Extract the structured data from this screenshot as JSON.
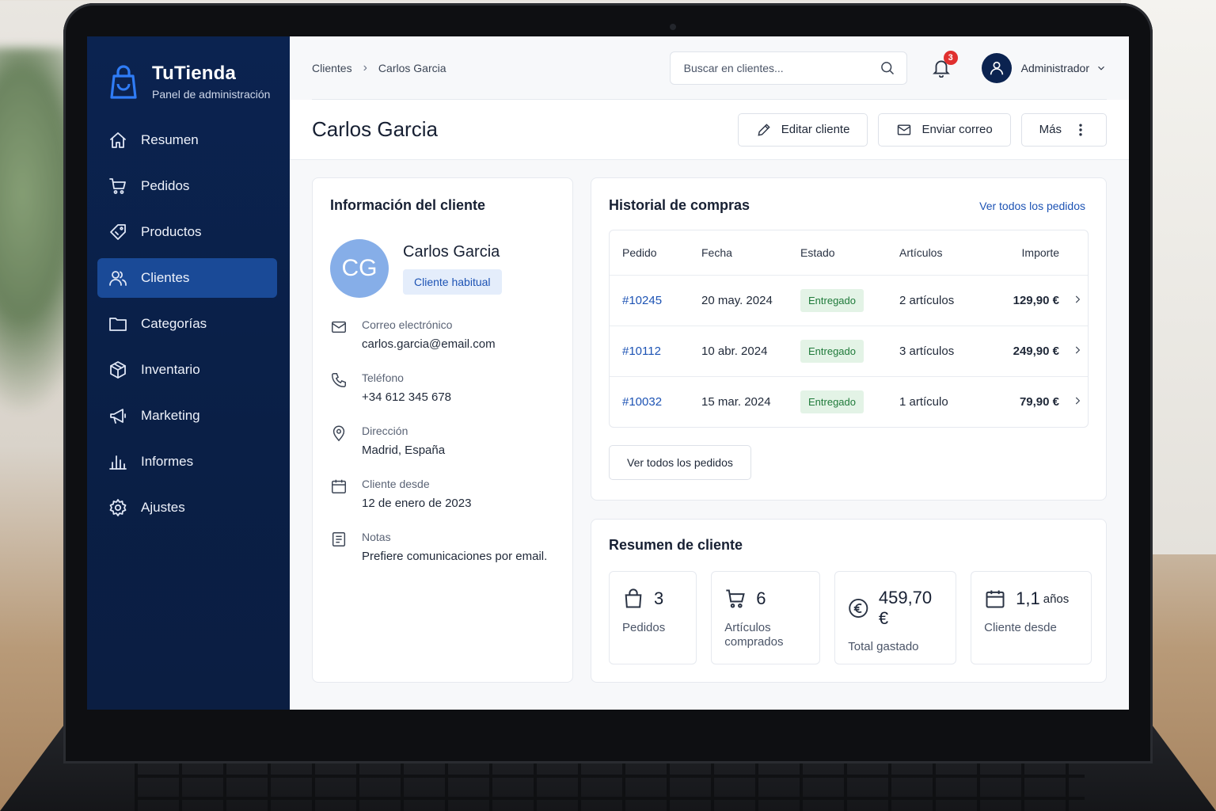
{
  "brand": {
    "name": "TuTienda",
    "subtitle": "Panel de administración"
  },
  "nav": [
    {
      "label": "Resumen",
      "icon": "home-icon",
      "active": false
    },
    {
      "label": "Pedidos",
      "icon": "cart-icon",
      "active": false
    },
    {
      "label": "Productos",
      "icon": "tag-icon",
      "active": false
    },
    {
      "label": "Clientes",
      "icon": "users-icon",
      "active": true
    },
    {
      "label": "Categorías",
      "icon": "folder-icon",
      "active": false
    },
    {
      "label": "Inventario",
      "icon": "box-icon",
      "active": false
    },
    {
      "label": "Marketing",
      "icon": "megaphone-icon",
      "active": false
    },
    {
      "label": "Informes",
      "icon": "bar-chart-icon",
      "active": false
    },
    {
      "label": "Ajustes",
      "icon": "gear-icon",
      "active": false
    }
  ],
  "breadcrumb": {
    "parent": "Clientes",
    "current": "Carlos Garcia"
  },
  "search": {
    "placeholder": "Buscar en clientes..."
  },
  "notifications": {
    "count": "3"
  },
  "user": {
    "name": "Administrador"
  },
  "page": {
    "title": "Carlos Garcia",
    "actions": {
      "edit": "Editar cliente",
      "email": "Enviar correo",
      "more": "Más"
    }
  },
  "client_info": {
    "title": "Información del cliente",
    "initials": "CG",
    "name": "Carlos Garcia",
    "tag": "Cliente habitual",
    "fields": [
      {
        "label": "Correo electrónico",
        "value": "carlos.garcia@email.com",
        "icon": "mail-icon"
      },
      {
        "label": "Teléfono",
        "value": "+34 612 345 678",
        "icon": "phone-icon"
      },
      {
        "label": "Dirección",
        "value": "Madrid, España",
        "icon": "location-icon"
      },
      {
        "label": "Cliente desde",
        "value": "12 de enero de 2023",
        "icon": "calendar-icon"
      },
      {
        "label": "Notas",
        "value": "Prefiere comunicaciones por email.",
        "icon": "notes-icon"
      }
    ]
  },
  "history": {
    "title": "Historial de compras",
    "view_all_link": "Ver todos los pedidos",
    "columns": [
      "Pedido",
      "Fecha",
      "Estado",
      "Artículos",
      "Importe"
    ],
    "rows": [
      {
        "order": "#10245",
        "date": "20 may. 2024",
        "status": "Entregado",
        "items": "2 artículos",
        "amount": "129,90 €"
      },
      {
        "order": "#10112",
        "date": "10 abr. 2024",
        "status": "Entregado",
        "items": "3 artículos",
        "amount": "249,90 €"
      },
      {
        "order": "#10032",
        "date": "15 mar. 2024",
        "status": "Entregado",
        "items": "1 artículo",
        "amount": "79,90 €"
      }
    ],
    "view_all_button": "Ver todos los pedidos"
  },
  "summary": {
    "title": "Resumen de cliente",
    "stats": [
      {
        "value": "3",
        "unit": "",
        "label": "Pedidos",
        "icon": "bag-icon"
      },
      {
        "value": "6",
        "unit": "",
        "label": "Artículos comprados",
        "icon": "cart-icon"
      },
      {
        "value": "459,70 €",
        "unit": "",
        "label": "Total gastado",
        "icon": "euro-icon"
      },
      {
        "value": "1,1",
        "unit": "años",
        "label": "Cliente desde",
        "icon": "calendar-icon"
      }
    ]
  },
  "colors": {
    "sidebar": "#0b2350",
    "accent": "#1d53b4",
    "active_nav": "#1a4a97",
    "status_green": "#1f7a3a",
    "badge": "#e0302f"
  }
}
